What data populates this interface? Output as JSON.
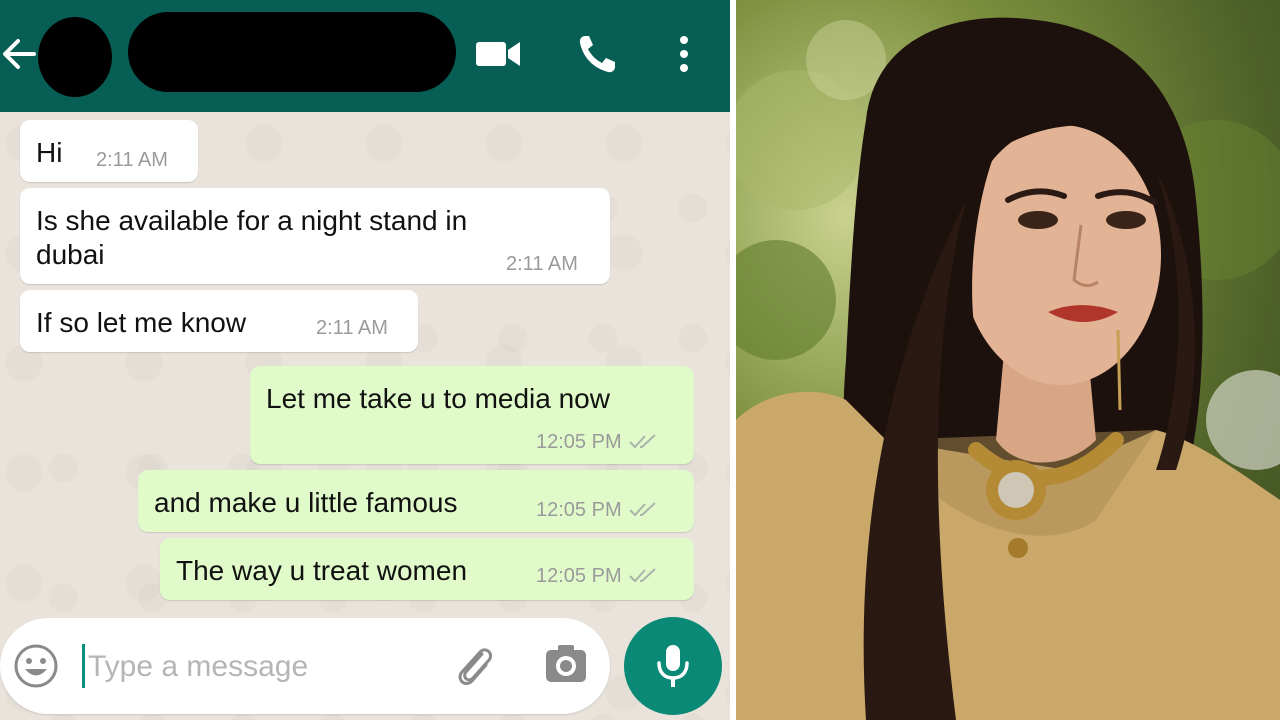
{
  "chat": {
    "header": {
      "back_icon": "arrow-left-icon",
      "contact_avatar": "redacted",
      "contact_name": "redacted",
      "video_icon": "video-camera-icon",
      "call_icon": "phone-icon",
      "menu_icon": "vertical-dots-icon"
    },
    "messages": [
      {
        "direction": "incoming",
        "text": "Hi",
        "time": "2:11 AM"
      },
      {
        "direction": "incoming",
        "text": "Is she available for a night stand in",
        "text2": "dubai",
        "time": "2:11 AM"
      },
      {
        "direction": "incoming",
        "text": "If so let me know",
        "time": "2:11 AM"
      },
      {
        "direction": "outgoing",
        "text": "Let me take u to media now",
        "time": "12:05 PM",
        "status": "read-ticks"
      },
      {
        "direction": "outgoing",
        "text": "and make u little famous",
        "time": "12:05 PM",
        "status": "read-ticks"
      },
      {
        "direction": "outgoing",
        "text": "The way u treat women",
        "time": "12:05 PM",
        "status": "read-ticks"
      }
    ],
    "composer": {
      "placeholder": "Type a message",
      "value": "",
      "emoji_icon": "emoji-icon",
      "attach_icon": "paperclip-icon",
      "camera_icon": "camera-icon",
      "mic_icon": "microphone-icon"
    }
  },
  "photo": {
    "subject": "woman-portrait-photo"
  },
  "colors": {
    "header": "#075e54",
    "chat_background": "#e9e3dc",
    "incoming_bubble": "#ffffff",
    "outgoing_bubble": "#e0fbc9",
    "mic_button": "#0a8a76",
    "timestamp": "#9a9a9a"
  }
}
